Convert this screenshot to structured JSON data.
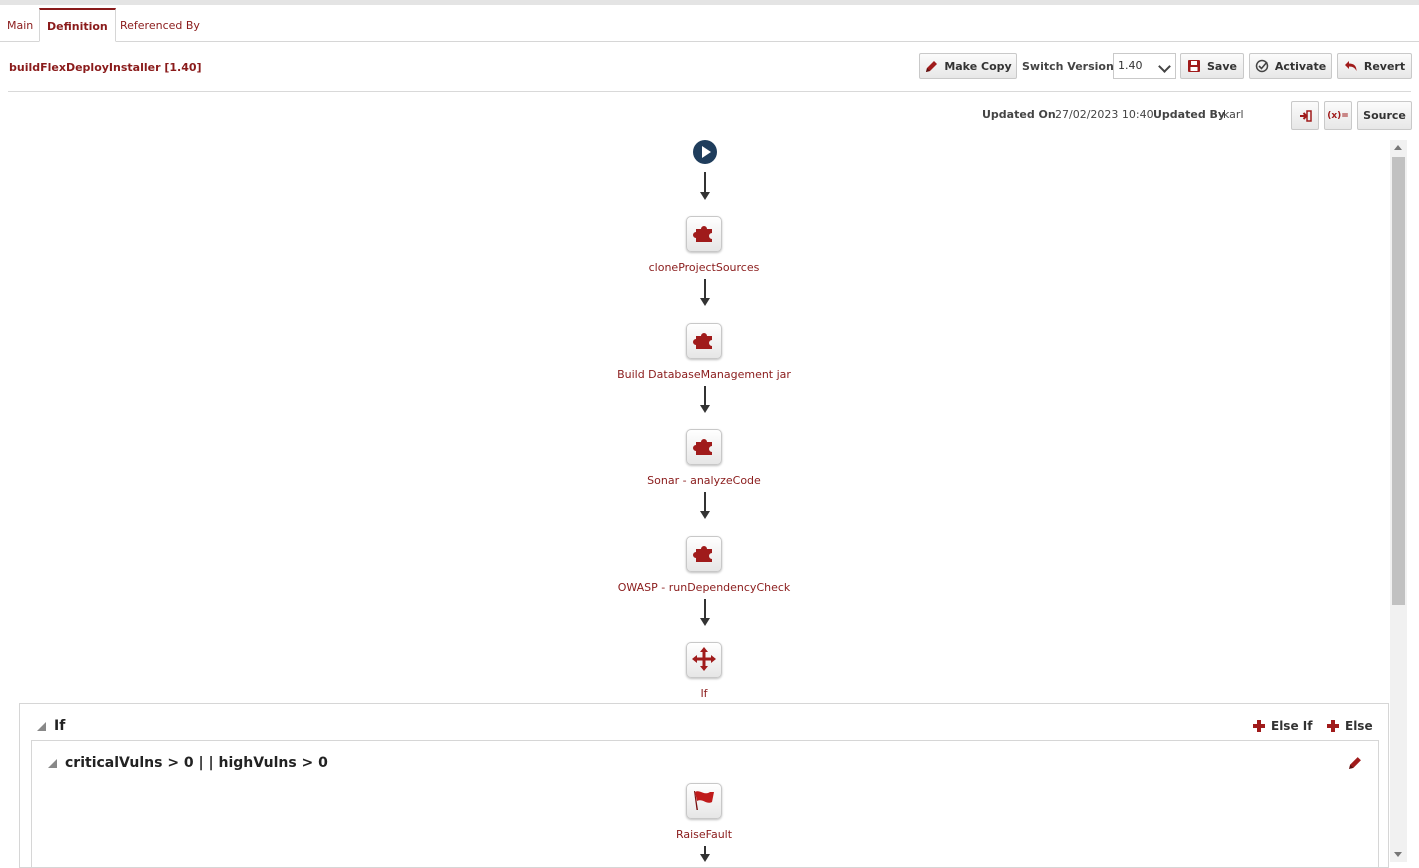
{
  "tabs": [
    {
      "label": "Main",
      "active": false
    },
    {
      "label": "Definition",
      "active": true
    },
    {
      "label": "Referenced By",
      "active": false
    }
  ],
  "header": {
    "title": "buildFlexDeployInstaller [1.40]",
    "make_copy_label": "Make Copy",
    "switch_version_label": "Switch Version",
    "version_selected": "1.40",
    "save_label": "Save",
    "activate_label": "Activate",
    "revert_label": "Revert"
  },
  "meta": {
    "updated_on_label": "Updated On",
    "updated_on_value": "27/02/2023 10:40",
    "updated_by_label": "Updated By",
    "updated_by_value": "karl",
    "variables_label": "(x)=",
    "source_label": "Source"
  },
  "flow": {
    "steps": [
      {
        "label": "cloneProjectSources",
        "icon": "puzzle-icon"
      },
      {
        "label": "Build DatabaseManagement jar",
        "icon": "puzzle-icon"
      },
      {
        "label": "Sonar - analyzeCode",
        "icon": "puzzle-icon"
      },
      {
        "label": "OWASP - runDependencyCheck",
        "icon": "puzzle-icon"
      },
      {
        "label": "If",
        "icon": "branch-arrows-icon"
      }
    ]
  },
  "if_block": {
    "title": "If",
    "else_if_label": "Else If",
    "else_label": "Else",
    "condition": "criticalVulns > 0 | | highVulns > 0",
    "inner_step": {
      "label": "RaiseFault",
      "icon": "flag-icon"
    }
  },
  "colors": {
    "accent": "#8a1b1b",
    "icon_red": "#a01b1b",
    "start_node": "#1f3d5c"
  }
}
